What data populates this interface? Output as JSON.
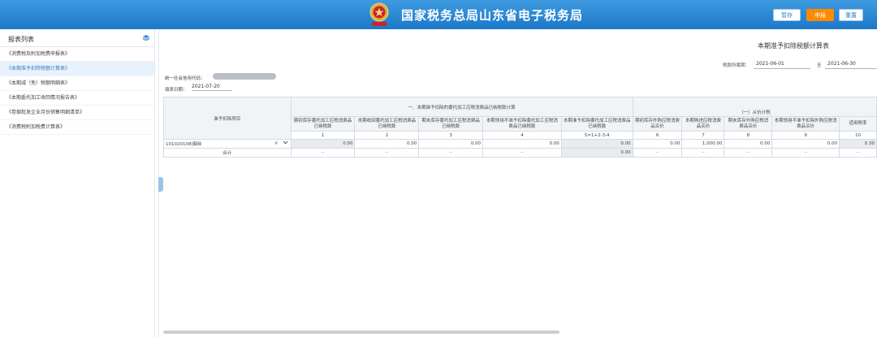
{
  "header": {
    "title": "国家税务总局山东省电子税务局",
    "buttons": {
      "save": "暂存",
      "submit": "申报",
      "reset": "重置"
    }
  },
  "sidebar": {
    "title": "报表列表",
    "items": [
      {
        "label": "《消费税及附加税费申报表》",
        "active": false
      },
      {
        "label": "《本期准予扣除税额计算表》",
        "active": true
      },
      {
        "label": "《本期减（免）税额明细表》",
        "active": false
      },
      {
        "label": "《本期委托加工收回情况报告表》",
        "active": false
      },
      {
        "label": "《卷烟批发企业月份销售明细清单》",
        "active": false
      },
      {
        "label": "《消费税附加税费计算表》",
        "active": false
      }
    ]
  },
  "form": {
    "title": "本期准予扣除税额计算表",
    "period_label": "税款所属期：",
    "period_from": "2021-06-01",
    "period_to_label": "至",
    "period_to": "2021-06-30",
    "credit_code_label": "统一社会信用代码：",
    "fill_date_label": "填表日期：",
    "fill_date": "2021-07-20"
  },
  "table": {
    "col_item_header": "准予扣除项目",
    "group1_header": "一、本期准予扣除的委托加工应税消费品已纳税款计算",
    "group2_header": "（一）从价计税",
    "headers": [
      "期初库存委托加工应税消费品已纳税款",
      "本期收回委托加工应税消费品已纳税款",
      "期末库存委托加工应税消费品已纳税款",
      "本期领用不准予扣除委托加工应税消费品已纳税款",
      "本期准予扣除委托加工应税消费品已纳税款",
      "期初库存外购应税消费品买价",
      "本期购进应税消费品买价",
      "期末库存外购应税消费品买价",
      "本期领用不准予扣除外购应税消费品买价",
      "适用税率"
    ],
    "col_numbers": [
      "1",
      "2",
      "3",
      "4",
      "5=1+2-3-4",
      "6",
      "7",
      "8",
      "9",
      "10"
    ],
    "row1": {
      "item": "101020108|烟丝",
      "clear_icon": "×",
      "values": [
        "0.00",
        "0.00",
        "0.00",
        "0.00",
        "0.00",
        "0.00",
        "1,000.00",
        "0.00",
        "0.00",
        "0.30"
      ]
    },
    "total_row": {
      "label": "合计",
      "values": [
        "--",
        "--",
        "--",
        "--",
        "0.00",
        "--",
        "--",
        "--",
        "--",
        "--"
      ]
    }
  },
  "colors": {
    "header_blue": "#1c78c9",
    "submit_orange": "#ff8a00",
    "active_item_bg": "#e8f2fc"
  }
}
